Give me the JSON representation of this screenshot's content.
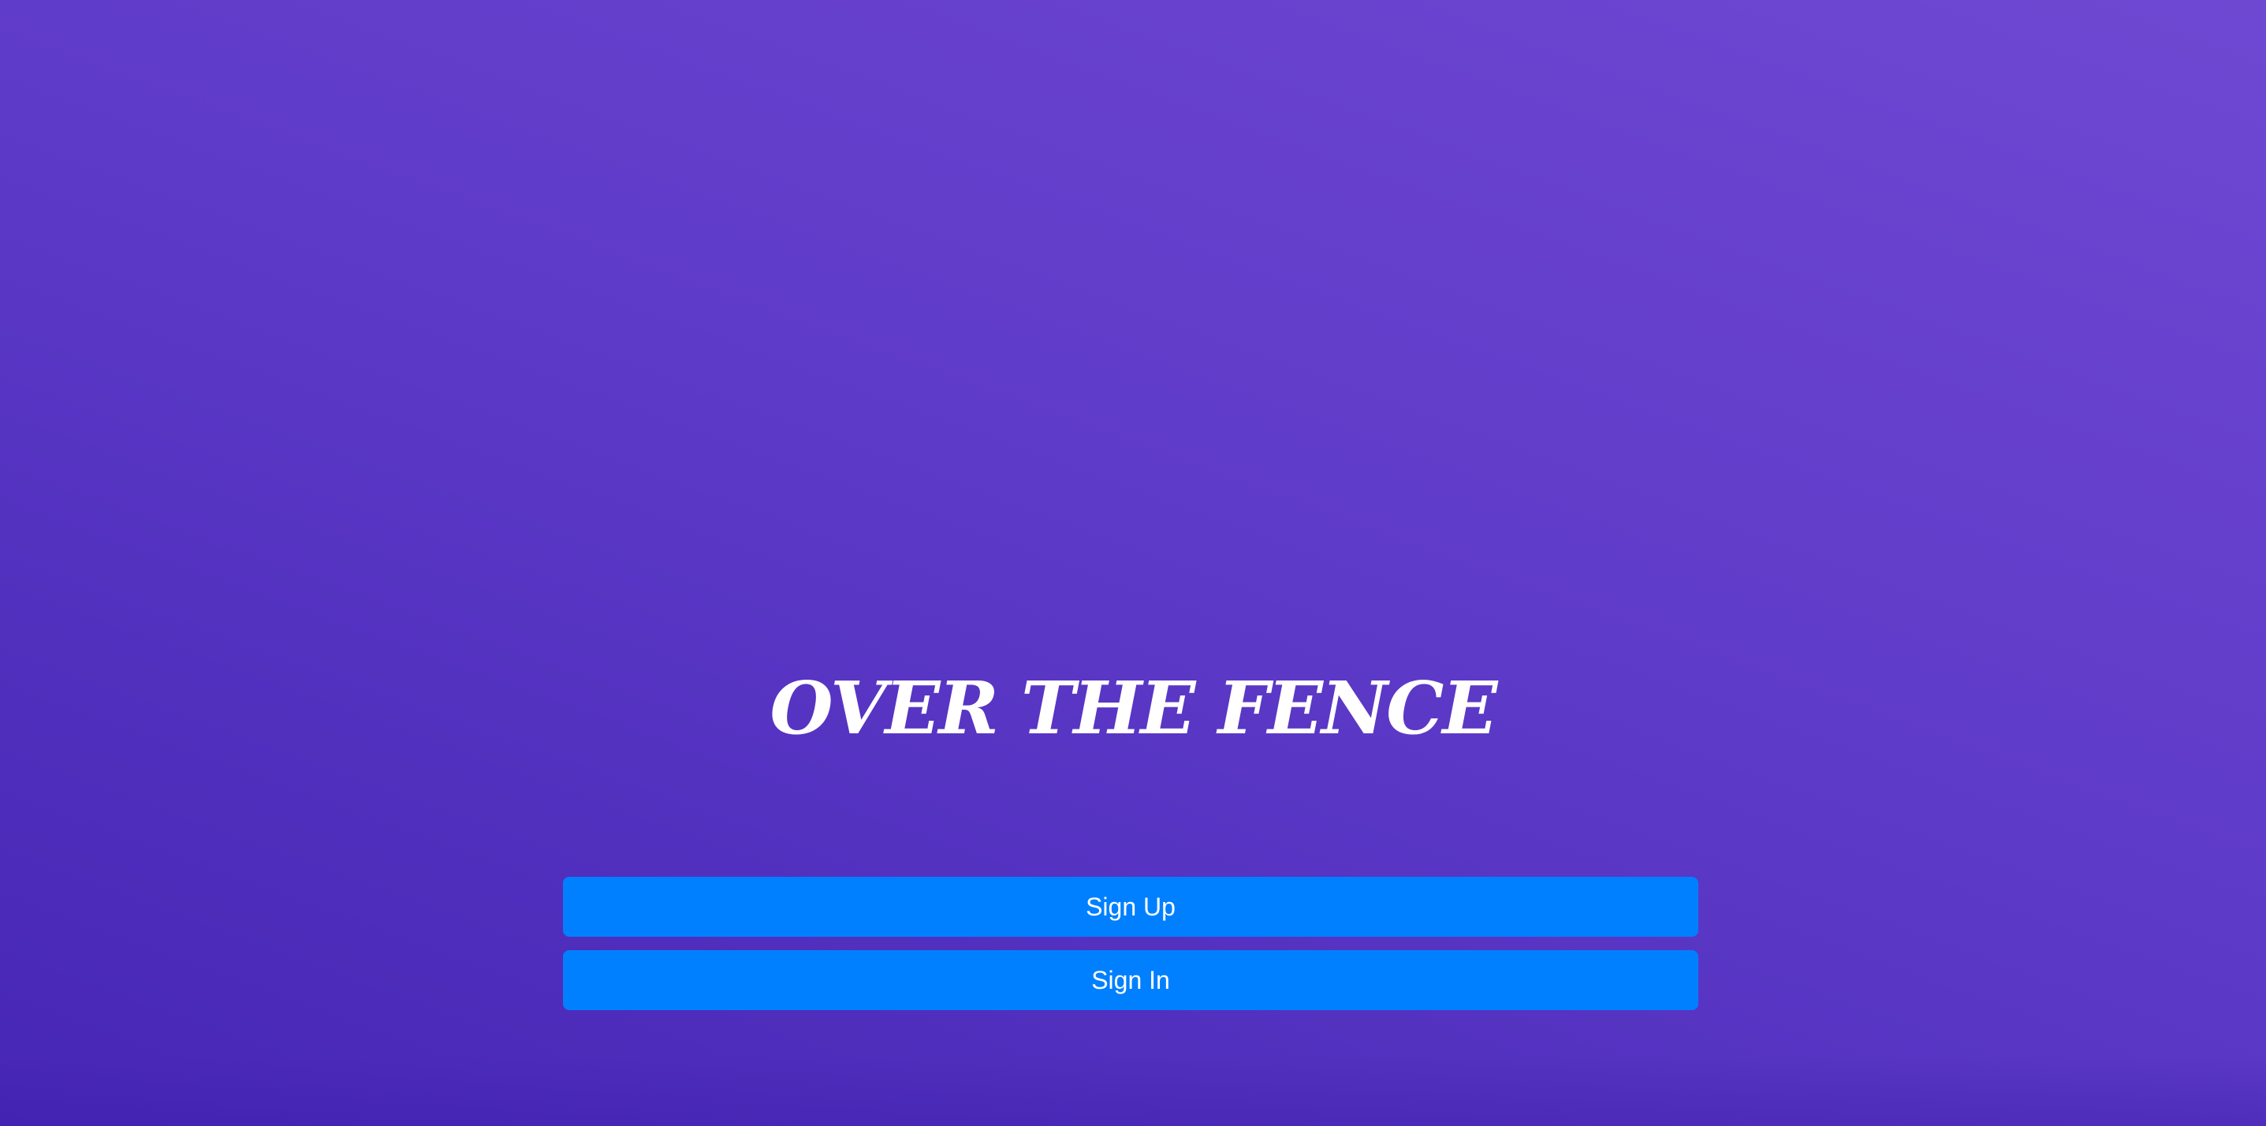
{
  "app": {
    "title": "OVER THE FENCE"
  },
  "actions": {
    "sign_up_label": "Sign Up",
    "sign_in_label": "Sign In"
  },
  "colors": {
    "background_top": "#6f48d2",
    "background_bottom": "#4626b5",
    "button": "#0080ff",
    "text": "#ffffff"
  }
}
